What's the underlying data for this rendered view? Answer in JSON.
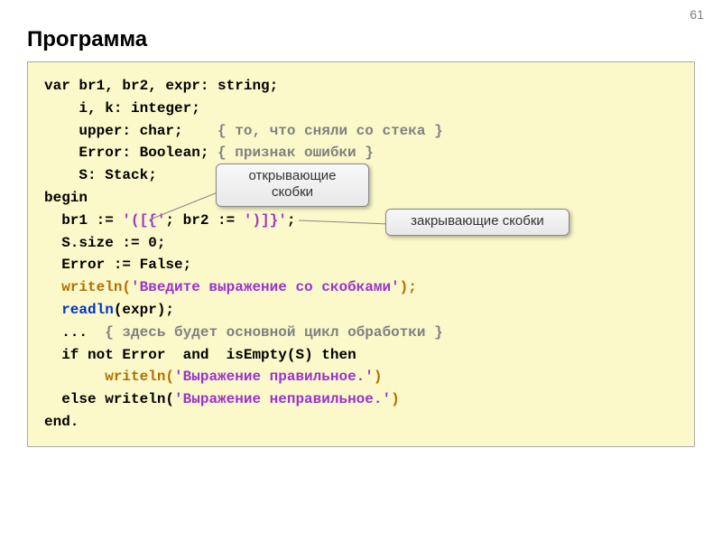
{
  "page_number": "61",
  "title": "Программа",
  "code": {
    "l1_a": "var ",
    "l1_b": "br1, br2, expr: string;",
    "l2": "    i, k: integer;",
    "l3_a": "    upper: char;    ",
    "l3_b": "{ то, что сняли со стека }",
    "l4_a": "    Error: Boolean; ",
    "l4_b": "{ признак ошибки }",
    "l5": "    S: Stack;",
    "l6": "begin",
    "l7_a": "  br1 :=",
    "l7_b": " '([{'",
    "l7_c": "; br2 :=",
    "l7_d": " ')]}'",
    "l7_e": ";",
    "l8_a": "  S.size := ",
    "l8_b": "0",
    "l8_c": ";",
    "l9": "  Error := False;",
    "l10_a": "  writeln(",
    "l10_b": "'Введите выражение со скобками'",
    "l10_c": ");",
    "l11_a": "  readln",
    "l11_b": "(expr);",
    "l12_a": "  ...  ",
    "l12_b": "{ здесь будет основной цикл обработки }",
    "l13_a": "  if not ",
    "l13_b": "Error",
    "l13_c": "  and  isEmpty(S) ",
    "l13_d": "then",
    "l14_a": "       writeln(",
    "l14_b": "'Выражение правильное.'",
    "l14_c": ")",
    "l15_a": "  else writeln(",
    "l15_b": "'Выражение неправильное.'",
    "l15_c": ")",
    "l16": "end."
  },
  "callouts": {
    "c1_line1": "открывающие",
    "c1_line2": "скобки",
    "c2": "закрывающие скобки"
  }
}
